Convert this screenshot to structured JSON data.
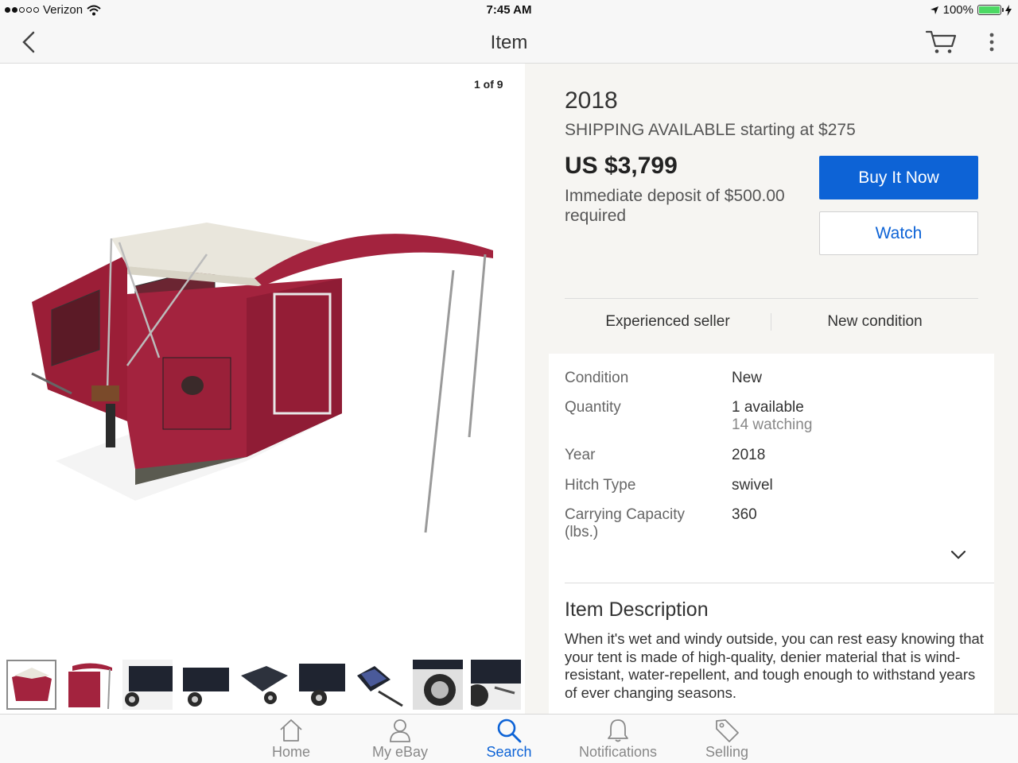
{
  "status_bar": {
    "carrier": "Verizon",
    "time": "7:45 AM",
    "battery": "100%"
  },
  "nav": {
    "title": "Item"
  },
  "gallery": {
    "counter": "1 of 9"
  },
  "item": {
    "title": "2018",
    "shipping": "SHIPPING AVAILABLE starting at $275",
    "price": "US $3,799",
    "deposit": "Immediate deposit of $500.00 required",
    "buy_label": "Buy It Now",
    "watch_label": "Watch"
  },
  "highlights": {
    "seller": "Experienced seller",
    "condition": "New condition"
  },
  "specs": [
    {
      "label": "Condition",
      "value": "New"
    },
    {
      "label": "Quantity",
      "value": "1 available",
      "sub": "14 watching"
    },
    {
      "label": "Year",
      "value": "2018"
    },
    {
      "label": "Hitch Type",
      "value": "swivel"
    },
    {
      "label": "Carrying Capacity (lbs.)",
      "value": "360"
    }
  ],
  "description": {
    "title": "Item Description",
    "text": "When it's wet and windy outside, you can rest easy knowing that your tent is made of high-quality, denier material that is wind-resistant, water-repellent, and tough enough to withstand years of ever changing seasons."
  },
  "tabs": [
    {
      "label": "Home",
      "icon": "home-icon"
    },
    {
      "label": "My eBay",
      "icon": "person-icon"
    },
    {
      "label": "Search",
      "icon": "search-icon",
      "active": true
    },
    {
      "label": "Notifications",
      "icon": "bell-icon"
    },
    {
      "label": "Selling",
      "icon": "tag-icon"
    }
  ],
  "colors": {
    "accent": "#0d63d6",
    "tent": "#a3233e",
    "battery": "#4cd964"
  }
}
